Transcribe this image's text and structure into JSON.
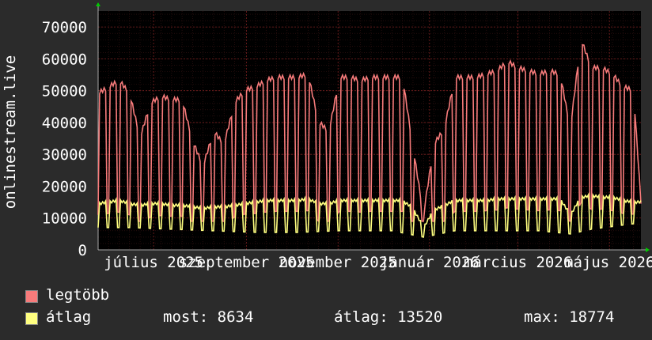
{
  "chart_data": {
    "type": "line",
    "ylabel": "onlinestream.live",
    "ylim": [
      0,
      75000
    ],
    "y_ticks": [
      0,
      10000,
      20000,
      30000,
      40000,
      50000,
      60000,
      70000
    ],
    "y_tick_labels": [
      "0",
      "10000",
      "20000",
      "30000",
      "40000",
      "50000",
      "60000",
      "70000"
    ],
    "x_tick_labels": [
      "július 2025",
      "szeptember 2025",
      "november 2025",
      "január 2026",
      "március 2026",
      "május 2026"
    ],
    "x_range": [
      "2025-05-25",
      "2026-05-22"
    ],
    "x_ticks": [
      "2025-07-01",
      "2025-09-01",
      "2025-11-01",
      "2026-01-01",
      "2026-03-01",
      "2026-05-01"
    ],
    "grid": true,
    "colors": {
      "background": "#000000",
      "grid": "#5a1a1a",
      "frame": "#2b2b2b"
    },
    "series": [
      {
        "name": "legtöbb",
        "color": "#f77b7b",
        "points": [
          [
            "2025-05-25",
            50000
          ],
          [
            "2025-06-01",
            52000
          ],
          [
            "2025-06-08",
            54000
          ],
          [
            "2025-06-15",
            50000
          ],
          [
            "2025-06-22",
            36000
          ],
          [
            "2025-06-29",
            47000
          ],
          [
            "2025-07-06",
            49000
          ],
          [
            "2025-07-13",
            48000
          ],
          [
            "2025-07-20",
            48000
          ],
          [
            "2025-07-27",
            35000
          ],
          [
            "2025-08-03",
            27000
          ],
          [
            "2025-08-10",
            38000
          ],
          [
            "2025-08-17",
            34000
          ],
          [
            "2025-08-24",
            47000
          ],
          [
            "2025-08-31",
            51000
          ],
          [
            "2025-09-07",
            52000
          ],
          [
            "2025-09-14",
            54000
          ],
          [
            "2025-09-21",
            55000
          ],
          [
            "2025-09-28",
            55000
          ],
          [
            "2025-10-05",
            55000
          ],
          [
            "2025-10-12",
            56000
          ],
          [
            "2025-10-19",
            41000
          ],
          [
            "2025-10-26",
            38000
          ],
          [
            "2025-11-02",
            55000
          ],
          [
            "2025-11-09",
            55000
          ],
          [
            "2025-11-16",
            54000
          ],
          [
            "2025-11-23",
            55000
          ],
          [
            "2025-11-30",
            55000
          ],
          [
            "2025-12-07",
            55000
          ],
          [
            "2025-12-14",
            55000
          ],
          [
            "2025-12-21",
            33000
          ],
          [
            "2025-12-28",
            12000
          ],
          [
            "2026-01-04",
            34000
          ],
          [
            "2026-01-11",
            39000
          ],
          [
            "2026-01-18",
            55000
          ],
          [
            "2026-01-25",
            55000
          ],
          [
            "2026-02-01",
            55000
          ],
          [
            "2026-02-08",
            56000
          ],
          [
            "2026-02-15",
            57000
          ],
          [
            "2026-02-22",
            60000
          ],
          [
            "2026-03-01",
            58000
          ],
          [
            "2026-03-08",
            57000
          ],
          [
            "2026-03-15",
            56000
          ],
          [
            "2026-03-22",
            57000
          ],
          [
            "2026-03-29",
            56000
          ],
          [
            "2026-04-05",
            39000
          ],
          [
            "2026-04-12",
            67000
          ],
          [
            "2026-04-19",
            58000
          ],
          [
            "2026-04-26",
            58000
          ],
          [
            "2026-05-03",
            56000
          ],
          [
            "2026-05-10",
            52000
          ],
          [
            "2026-05-17",
            51000
          ],
          [
            "2026-05-22",
            16000
          ]
        ]
      },
      {
        "name": "átlag",
        "color": "#ffff80",
        "points": [
          [
            "2025-05-25",
            15500
          ],
          [
            "2025-06-01",
            16000
          ],
          [
            "2025-06-08",
            16500
          ],
          [
            "2025-06-15",
            15500
          ],
          [
            "2025-06-22",
            15000
          ],
          [
            "2025-06-29",
            15500
          ],
          [
            "2025-07-06",
            15500
          ],
          [
            "2025-07-13",
            15000
          ],
          [
            "2025-07-20",
            15000
          ],
          [
            "2025-07-27",
            14500
          ],
          [
            "2025-08-03",
            14000
          ],
          [
            "2025-08-10",
            14500
          ],
          [
            "2025-08-17",
            14500
          ],
          [
            "2025-08-24",
            15000
          ],
          [
            "2025-08-31",
            15500
          ],
          [
            "2025-09-07",
            16000
          ],
          [
            "2025-09-14",
            16500
          ],
          [
            "2025-09-21",
            16500
          ],
          [
            "2025-09-28",
            16500
          ],
          [
            "2025-10-05",
            16500
          ],
          [
            "2025-10-12",
            17000
          ],
          [
            "2025-10-19",
            15500
          ],
          [
            "2025-10-26",
            15500
          ],
          [
            "2025-11-02",
            16500
          ],
          [
            "2025-11-09",
            16500
          ],
          [
            "2025-11-16",
            16500
          ],
          [
            "2025-11-23",
            16500
          ],
          [
            "2025-11-30",
            16500
          ],
          [
            "2025-12-07",
            16500
          ],
          [
            "2025-12-14",
            16500
          ],
          [
            "2025-12-21",
            14000
          ],
          [
            "2025-12-28",
            8000
          ],
          [
            "2026-01-04",
            13500
          ],
          [
            "2026-01-11",
            15000
          ],
          [
            "2026-01-18",
            16500
          ],
          [
            "2026-01-25",
            16500
          ],
          [
            "2026-02-01",
            16500
          ],
          [
            "2026-02-08",
            16500
          ],
          [
            "2026-02-15",
            17000
          ],
          [
            "2026-02-22",
            17000
          ],
          [
            "2026-03-01",
            17000
          ],
          [
            "2026-03-08",
            17000
          ],
          [
            "2026-03-15",
            17000
          ],
          [
            "2026-03-22",
            17000
          ],
          [
            "2026-03-29",
            17000
          ],
          [
            "2026-04-05",
            12000
          ],
          [
            "2026-04-12",
            17500
          ],
          [
            "2026-04-19",
            18000
          ],
          [
            "2026-04-26",
            17500
          ],
          [
            "2026-05-03",
            17500
          ],
          [
            "2026-05-10",
            16500
          ],
          [
            "2026-05-17",
            16000
          ],
          [
            "2026-05-22",
            16000
          ]
        ],
        "lows": [
          [
            "2025-05-25",
            7000
          ],
          [
            "2025-06-15",
            7000
          ],
          [
            "2025-07-13",
            6500
          ],
          [
            "2025-08-10",
            6000
          ],
          [
            "2025-09-07",
            5500
          ],
          [
            "2025-10-05",
            5500
          ],
          [
            "2025-11-02",
            6000
          ],
          [
            "2025-12-07",
            6000
          ],
          [
            "2025-12-28",
            4000
          ],
          [
            "2026-01-18",
            6000
          ],
          [
            "2026-02-15",
            6000
          ],
          [
            "2026-03-15",
            6000
          ],
          [
            "2026-04-05",
            5000
          ],
          [
            "2026-04-19",
            6500
          ],
          [
            "2026-05-22",
            8500
          ]
        ]
      }
    ]
  },
  "legend": {
    "max_name": "legtöbb",
    "avg_name": "átlag",
    "now_text": "most: 8634",
    "avg_text": "átlag: 13520",
    "max_text": "max: 18774"
  }
}
